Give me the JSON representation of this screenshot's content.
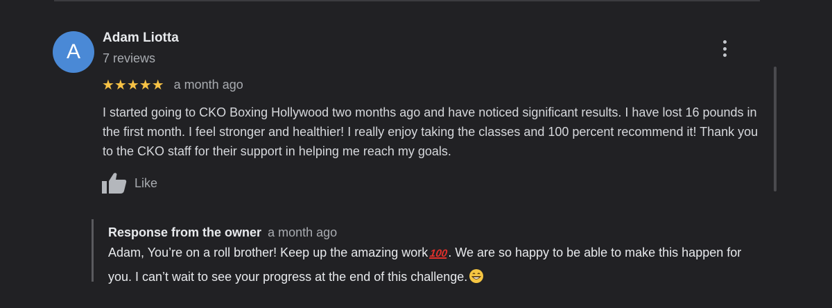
{
  "review": {
    "avatar_letter": "A",
    "reviewer_name": "Adam Liotta",
    "review_count": "7 reviews",
    "rating": 5,
    "stars": "★★★★★",
    "time": "a month ago",
    "text": "I started going to CKO Boxing Hollywood two months ago and have noticed significant results. I have lost 16 pounds in the first month. I feel stronger and healthier! I really enjoy taking the classes and 100 percent recommend it! Thank you to the CKO staff for their support in helping me reach my goals.",
    "like_label": "Like",
    "more_icon": "more-vert-icon",
    "like_icon": "thumbs-up-icon"
  },
  "owner_response": {
    "title": "Response from the owner",
    "time": "a month ago",
    "text_part1": "Adam, You’re on a roll brother! Keep up the amazing work",
    "emoji_100": "💯",
    "text_part2": ". We are so happy to be able to make this happen for you. I can’t wait to see your progress at the end of this challenge.",
    "emoji_grin": "😁"
  },
  "colors": {
    "background": "#212124",
    "avatar": "#4a89d6",
    "star": "#f7c245",
    "text_primary": "#e8eaed",
    "text_secondary": "#a8abb0"
  }
}
